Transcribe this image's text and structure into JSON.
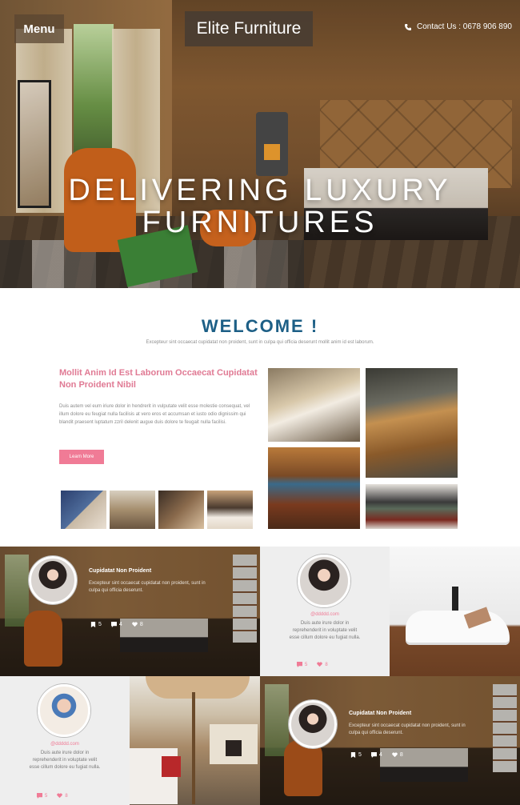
{
  "header": {
    "menu_label": "Menu",
    "brand": "Elite Furniture",
    "contact": "Contact Us : 0678 906 890",
    "hero_line1": "DELIVERING LUXURY",
    "hero_line2": "FURNITURES"
  },
  "welcome": {
    "title": "WELCOME !",
    "subtitle": "Excepteur sint occaecat cupidatat non proident, sunt in culpa qui officia deserunt mollit anim id est laborum.",
    "feature_title": "Mollit Anim Id Est Laborum Occaecat Cupidatat Non Proident Nibil",
    "feature_text": "Duis autem vel eum iriure dolor in hendrerit in vulputate velit esse molestie consequat, vel illum dolore eu feugiat nulla facilisis at vero eros et accumsan et iusto odio dignissim qui blandit praesent luptatum zzril delenit augue duis dolore te feugait nulla facilisi.",
    "learn_more": "Learn More"
  },
  "posts": [
    {
      "title": "Cupidatat Non Proident",
      "text": "Excepteur sint occaecat cupidatat non proident, sunt in culpa qui officia deserunt.",
      "bookmarks": "5",
      "comments": "4",
      "likes": "8"
    },
    {
      "link": "@ddddd.com",
      "text": "Duis aute irure dolor in reprehenderit in voluptate velit esse cillum dolore eu fugiat nulla.",
      "comments": "5",
      "likes": "8"
    },
    {
      "link": "@ddddd.com",
      "text": "Duis aute irure dolor in reprehenderit in voluptate velit esse cillum dolore eu fugiat nulla.",
      "comments": "5",
      "likes": "8"
    },
    {
      "title": "Cupidatat Non Proident",
      "text": "Excepteur sint occaecat cupidatat non proident, sunt in culpa qui officia deserunt.",
      "bookmarks": "5",
      "comments": "4",
      "likes": "8"
    }
  ],
  "colors": {
    "welcome_blue": "#1d5f86",
    "accent_pink": "#f07b96"
  },
  "icons": {
    "contact": "phone-icon",
    "bookmark": "bookmark-icon",
    "comment": "comment-icon",
    "like": "heart-icon"
  }
}
